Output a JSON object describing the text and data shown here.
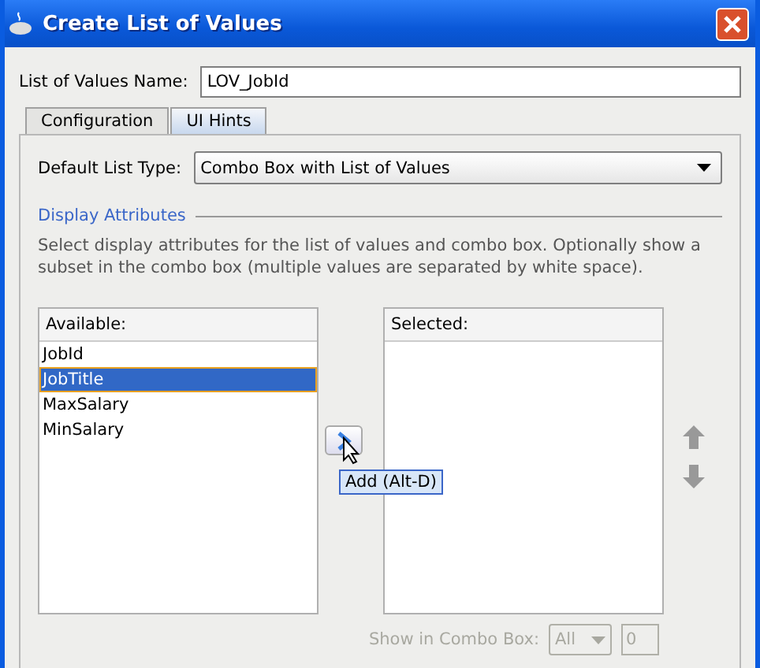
{
  "window": {
    "title": "Create List of Values"
  },
  "name_field": {
    "label": "List of Values Name:",
    "value": "LOV_JobId"
  },
  "tabs": [
    {
      "label": "Configuration",
      "selected": false
    },
    {
      "label": "UI Hints",
      "selected": true
    }
  ],
  "list_type": {
    "label": "Default List Type:",
    "value": "Combo Box with List of Values"
  },
  "section": {
    "title": "Display Attributes",
    "description": "Select display attributes for the list of values and combo box. Optionally show a subset in the combo box (multiple values are separated by white space)."
  },
  "available": {
    "header": "Available:",
    "items": [
      {
        "label": "JobId",
        "selected": false
      },
      {
        "label": "JobTitle",
        "selected": true
      },
      {
        "label": "MaxSalary",
        "selected": false
      },
      {
        "label": "MinSalary",
        "selected": false
      }
    ]
  },
  "selected_list": {
    "header": "Selected:"
  },
  "tooltip": "Add (Alt-D)",
  "show_in_combo": {
    "label": "Show in Combo Box:",
    "value": "All",
    "count": "0",
    "disabled": true
  }
}
